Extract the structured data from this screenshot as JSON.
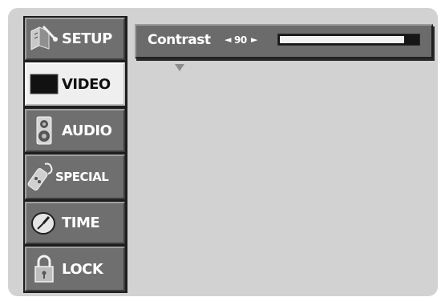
{
  "menu": {
    "items": [
      {
        "label": "SETUP",
        "icon": "setup-icon"
      },
      {
        "label": "VIDEO",
        "icon": "video-icon",
        "selected": true
      },
      {
        "label": "AUDIO",
        "icon": "audio-icon"
      },
      {
        "label": "SPECIAL",
        "icon": "special-icon"
      },
      {
        "label": "TIME",
        "icon": "time-icon"
      },
      {
        "label": "LOCK",
        "icon": "lock-icon"
      }
    ]
  },
  "setting": {
    "label": "Contrast",
    "left_arrow": "◄",
    "value": "90",
    "right_arrow": "►",
    "level_percent": 90
  },
  "colors": {
    "screen_bg": "#d2d2d2",
    "tab_bg": "#6f6f6f",
    "tab_selected_bg": "#efefef",
    "bar_bg": "#6b6b6b"
  }
}
